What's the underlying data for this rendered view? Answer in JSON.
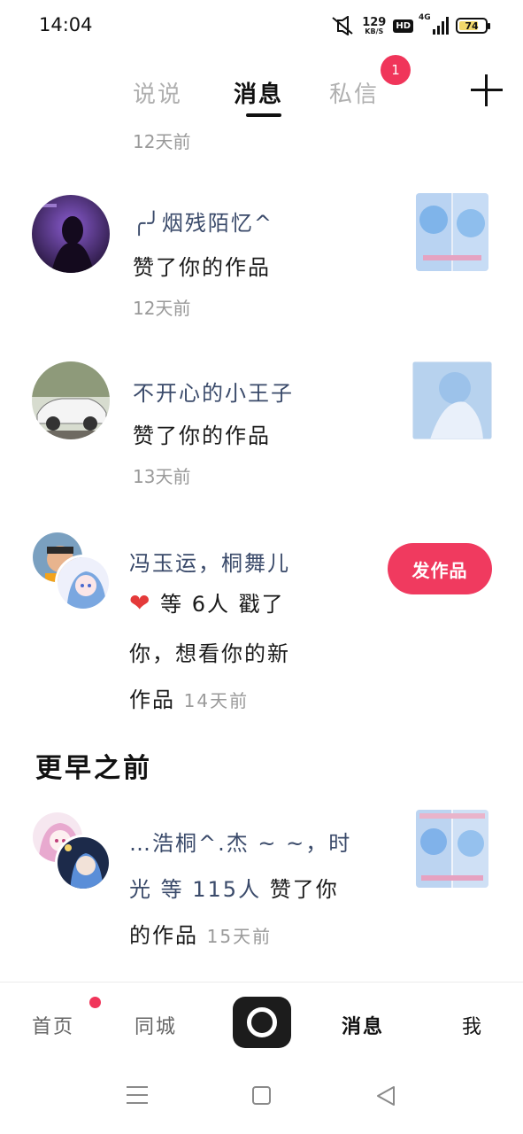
{
  "status_bar": {
    "time": "14:04",
    "network_speed": "129",
    "network_unit": "KB/S",
    "hd_label": "HD",
    "signal_label": "4G",
    "battery_percent": "74",
    "battery_level": 0.74
  },
  "tabs": {
    "shuoshuo": "说说",
    "messages": "消息",
    "private": "私信",
    "private_badge": "1"
  },
  "top_time": "12天前",
  "notifications": [
    {
      "name": "╭╯烟残陌忆^",
      "action": "赞了你的作品",
      "time": "12天前"
    },
    {
      "name": "不开心的小王子",
      "action": "赞了你的作品",
      "time": "13天前"
    },
    {
      "names": "冯玉运，桐舞儿",
      "heart": "❤",
      "action_line1": "等 6人 戳了",
      "action_line2": "你，想看你的新",
      "action_line3": "作品",
      "time": "14天前",
      "button": "发作品"
    }
  ],
  "section_title": "更早之前",
  "earlier": [
    {
      "names": "…浩桐^.杰 ~ ~，时",
      "names_line2": "光",
      "count": "等 115人",
      "action": "赞了你",
      "action_line2": "的作品",
      "time": "15天前"
    }
  ],
  "bottom_nav": {
    "home": "首页",
    "city": "同城",
    "messages": "消息",
    "me": "我"
  },
  "colors": {
    "accent": "#f0355a",
    "name_text": "#3a4a6a",
    "secondary_text": "#9a9a9a"
  }
}
